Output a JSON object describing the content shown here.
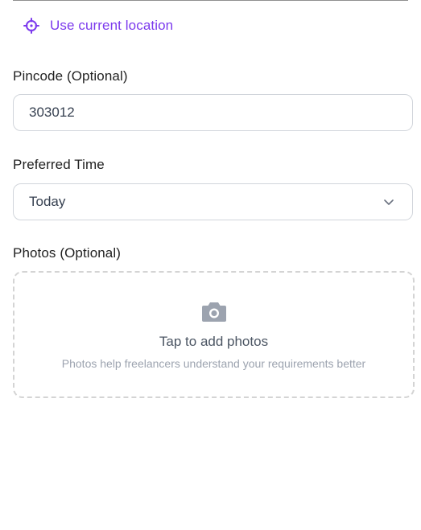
{
  "location": {
    "label": "Use current location",
    "icon": "crosshair-icon",
    "color": "#7c3aed"
  },
  "pincode": {
    "label": "Pincode (Optional)",
    "value": "303012"
  },
  "preferred_time": {
    "label": "Preferred Time",
    "selected": "Today",
    "icon": "chevron-down-icon"
  },
  "photos": {
    "label": "Photos (Optional)",
    "icon": "camera-icon",
    "title": "Tap to add photos",
    "hint": "Photos help freelancers understand your requirements better"
  }
}
